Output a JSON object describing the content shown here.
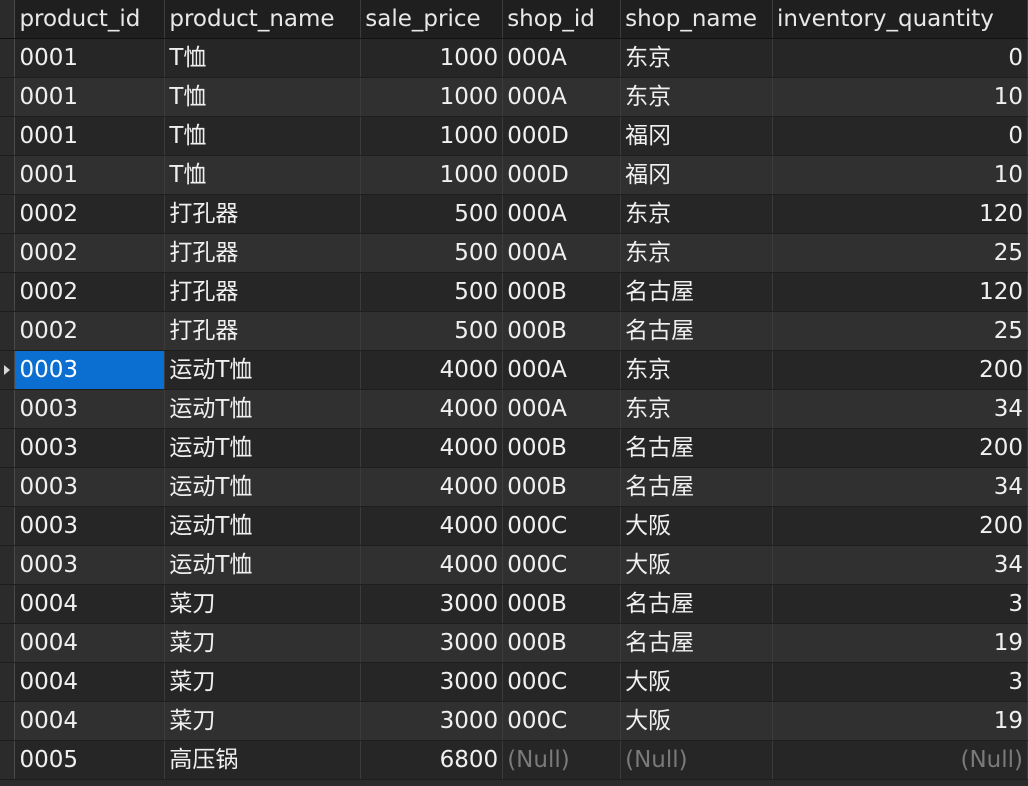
{
  "columns": [
    {
      "key": "product_id",
      "label": "product_id",
      "align": "left"
    },
    {
      "key": "product_name",
      "label": "product_name",
      "align": "left"
    },
    {
      "key": "sale_price",
      "label": "sale_price",
      "align": "right"
    },
    {
      "key": "shop_id",
      "label": "shop_id",
      "align": "left"
    },
    {
      "key": "shop_name",
      "label": "shop_name",
      "align": "left"
    },
    {
      "key": "inventory_quantity",
      "label": "inventory_quantity",
      "align": "right"
    }
  ],
  "rows": [
    [
      "0001",
      "T恤",
      "1000",
      "000A",
      "东京",
      "0"
    ],
    [
      "0001",
      "T恤",
      "1000",
      "000A",
      "东京",
      "10"
    ],
    [
      "0001",
      "T恤",
      "1000",
      "000D",
      "福冈",
      "0"
    ],
    [
      "0001",
      "T恤",
      "1000",
      "000D",
      "福冈",
      "10"
    ],
    [
      "0002",
      "打孔器",
      "500",
      "000A",
      "东京",
      "120"
    ],
    [
      "0002",
      "打孔器",
      "500",
      "000A",
      "东京",
      "25"
    ],
    [
      "0002",
      "打孔器",
      "500",
      "000B",
      "名古屋",
      "120"
    ],
    [
      "0002",
      "打孔器",
      "500",
      "000B",
      "名古屋",
      "25"
    ],
    [
      "0003",
      "运动T恤",
      "4000",
      "000A",
      "东京",
      "200"
    ],
    [
      "0003",
      "运动T恤",
      "4000",
      "000A",
      "东京",
      "34"
    ],
    [
      "0003",
      "运动T恤",
      "4000",
      "000B",
      "名古屋",
      "200"
    ],
    [
      "0003",
      "运动T恤",
      "4000",
      "000B",
      "名古屋",
      "34"
    ],
    [
      "0003",
      "运动T恤",
      "4000",
      "000C",
      "大阪",
      "200"
    ],
    [
      "0003",
      "运动T恤",
      "4000",
      "000C",
      "大阪",
      "34"
    ],
    [
      "0004",
      "菜刀",
      "3000",
      "000B",
      "名古屋",
      "3"
    ],
    [
      "0004",
      "菜刀",
      "3000",
      "000B",
      "名古屋",
      "19"
    ],
    [
      "0004",
      "菜刀",
      "3000",
      "000C",
      "大阪",
      "3"
    ],
    [
      "0004",
      "菜刀",
      "3000",
      "000C",
      "大阪",
      "19"
    ],
    [
      "0005",
      "高压锅",
      "6800",
      "(Null)",
      "(Null)",
      "(Null)"
    ]
  ],
  "null_text": "(Null)",
  "selection": {
    "row": 8,
    "col": 0
  },
  "current_row_icon": "row-pointer-icon",
  "colors": {
    "selected": "#0b6fd1",
    "null_text": "#7a7a7a"
  }
}
